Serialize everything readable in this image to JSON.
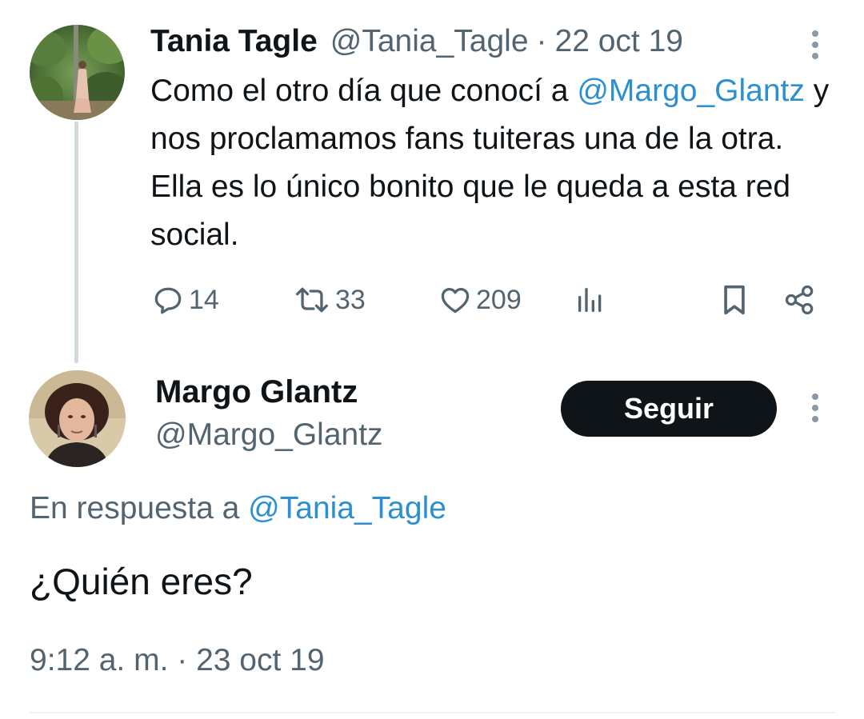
{
  "tweet1": {
    "display_name": "Tania Tagle",
    "handle": "@Tania_Tagle",
    "separator": "·",
    "date": "22 oct 19",
    "text_before_mention": "Como el otro día que conocí a ",
    "mention": "@Margo_Glantz",
    "text_after_mention": " y nos proclamamos fans tuiteras una de la otra. Ella es lo único bonito que le queda a esta red social.",
    "actions": {
      "replies": "14",
      "retweets": "33",
      "likes": "209"
    }
  },
  "tweet2": {
    "display_name": "Margo Glantz",
    "handle": "@Margo_Glantz",
    "follow_label": "Seguir",
    "reply_prefix": "En respuesta a ",
    "reply_to": "@Tania_Tagle",
    "text": "¿Quién eres?",
    "timestamp": "9:12 a. m. · 23 oct 19"
  },
  "icons": {
    "reply": "speech-bubble-icon",
    "retweet": "retweet-icon",
    "like": "heart-icon",
    "views": "bar-chart-icon",
    "bookmark": "bookmark-icon",
    "share": "share-icon",
    "more": "more-vertical-icon"
  },
  "colors": {
    "text": "#0f1419",
    "muted": "#536471",
    "link": "#2b8fd0",
    "follow_button_bg": "#0f1419",
    "thread_line": "#cfd9de"
  }
}
